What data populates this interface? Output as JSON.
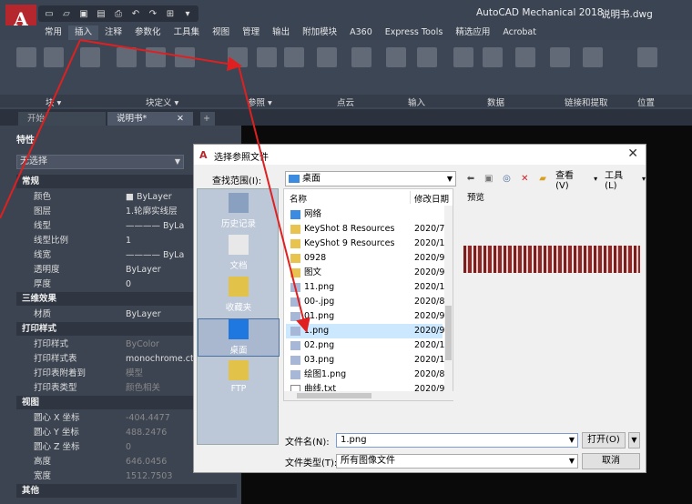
{
  "app": {
    "logo": "A",
    "title": "AutoCAD Mechanical 2018",
    "document": "说明书.dwg"
  },
  "ribbon": {
    "tabs": [
      "常用",
      "插入",
      "注释",
      "参数化",
      "工具集",
      "视图",
      "管理",
      "输出",
      "附加模块",
      "A360",
      "Express Tools",
      "精选应用",
      "Acrobat"
    ],
    "active_tab": "插入",
    "panels": [
      "块 ▾",
      "块定义 ▾",
      "参照 ▾",
      "点云",
      "输入",
      "数据",
      "链接和提取",
      "位置"
    ]
  },
  "file_tabs": {
    "start": "开始",
    "doc": "说明书*",
    "plus": "+"
  },
  "properties": {
    "title": "特性",
    "selection": "无选择",
    "sections": [
      {
        "header": "常规",
        "rows": [
          {
            "label": "颜色",
            "value": "■ ByLayer",
            "dim": false
          },
          {
            "label": "图层",
            "value": "1.轮廓实线层",
            "dim": false
          },
          {
            "label": "线型",
            "value": "———— ByLa",
            "dim": false
          },
          {
            "label": "线型比例",
            "value": "1",
            "dim": false
          },
          {
            "label": "线宽",
            "value": "———— ByLa",
            "dim": false
          },
          {
            "label": "透明度",
            "value": "ByLayer",
            "dim": false
          },
          {
            "label": "厚度",
            "value": "0",
            "dim": false
          }
        ]
      },
      {
        "header": "三维效果",
        "rows": [
          {
            "label": "材质",
            "value": "ByLayer",
            "dim": false
          }
        ]
      },
      {
        "header": "打印样式",
        "rows": [
          {
            "label": "打印样式",
            "value": "ByColor",
            "dim": true
          },
          {
            "label": "打印样式表",
            "value": "monochrome.ctb",
            "dim": false
          },
          {
            "label": "打印表附着到",
            "value": "模型",
            "dim": true
          },
          {
            "label": "打印表类型",
            "value": "颜色相关",
            "dim": true
          }
        ]
      },
      {
        "header": "视图",
        "rows": [
          {
            "label": "圆心 X 坐标",
            "value": "-404.4477",
            "dim": true
          },
          {
            "label": "圆心 Y 坐标",
            "value": "488.2476",
            "dim": true
          },
          {
            "label": "圆心 Z 坐标",
            "value": "0",
            "dim": true
          },
          {
            "label": "高度",
            "value": "646.0456",
            "dim": true
          },
          {
            "label": "宽度",
            "value": "1512.7503",
            "dim": true
          }
        ]
      },
      {
        "header": "其他",
        "rows": []
      }
    ]
  },
  "dialog": {
    "title": "选择参照文件",
    "close": "✕",
    "look_in_label": "查找范围(I):",
    "look_in_value": "桌面",
    "toolbar": {
      "view": "查看(V)",
      "tools": "工具(L)"
    },
    "places": [
      "历史记录",
      "文档",
      "收藏夹",
      "桌面",
      "FTP"
    ],
    "columns": {
      "name": "名称",
      "date": "修改日期"
    },
    "files": [
      {
        "name": "网络",
        "date": "",
        "type": "network"
      },
      {
        "name": "KeyShot 8 Resources",
        "date": "2020/7",
        "type": "folder"
      },
      {
        "name": "KeyShot 9 Resources",
        "date": "2020/1",
        "type": "folder"
      },
      {
        "name": "0928",
        "date": "2020/9",
        "type": "folder"
      },
      {
        "name": "图文",
        "date": "2020/9",
        "type": "folder"
      },
      {
        "name": "11.png",
        "date": "2020/1",
        "type": "image"
      },
      {
        "name": "00-.jpg",
        "date": "2020/8",
        "type": "image"
      },
      {
        "name": "01.png",
        "date": "2020/9",
        "type": "image"
      },
      {
        "name": "1.png",
        "date": "2020/9",
        "type": "image",
        "selected": true
      },
      {
        "name": "02.png",
        "date": "2020/1",
        "type": "image"
      },
      {
        "name": "03.png",
        "date": "2020/1",
        "type": "image"
      },
      {
        "name": "绘图1.png",
        "date": "2020/8",
        "type": "image"
      },
      {
        "name": "曲线.txt",
        "date": "2020/9",
        "type": "text"
      }
    ],
    "preview_label": "预览",
    "filename_label": "文件名(N):",
    "filename_value": "1.png",
    "filetype_label": "文件类型(T):",
    "filetype_value": "所有图像文件",
    "open_label": "打开(O)",
    "cancel_label": "取消"
  },
  "colors": {
    "accent": "#b5272d",
    "selection": "#cce8ff",
    "annotation_arrow": "#e02020"
  }
}
